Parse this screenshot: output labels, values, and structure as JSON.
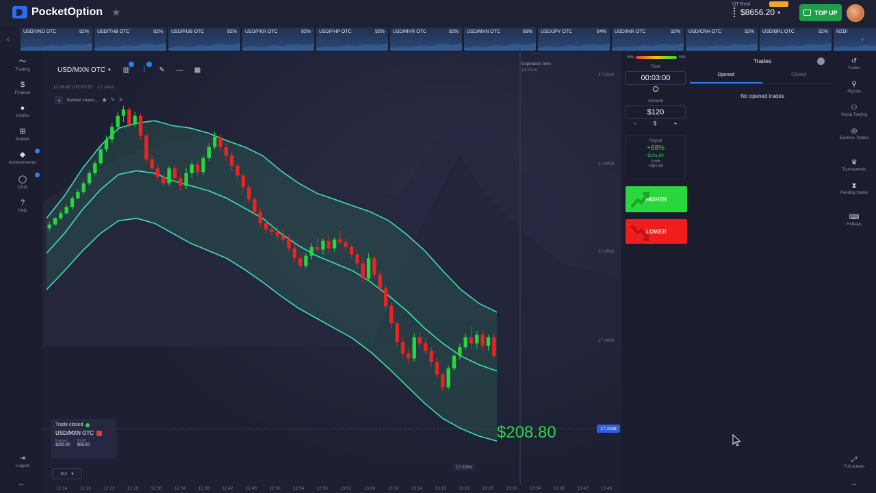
{
  "brand": {
    "name": "PocketOption"
  },
  "header": {
    "account_mode": "QT Real",
    "balance": "$8656.20",
    "topup_label": "TOP UP"
  },
  "asset_strip": [
    {
      "name": "USD/VND OTC",
      "payout": "92%"
    },
    {
      "name": "USD/THB OTC",
      "payout": "92%"
    },
    {
      "name": "USD/RUB OTC",
      "payout": "92%"
    },
    {
      "name": "USD/PKR OTC",
      "payout": "92%"
    },
    {
      "name": "USD/PHP OTC",
      "payout": "92%"
    },
    {
      "name": "USD/MYR OTC",
      "payout": "92%"
    },
    {
      "name": "USD/MXN OTC",
      "payout": "68%"
    },
    {
      "name": "USD/JPY OTC",
      "payout": "64%"
    },
    {
      "name": "USD/INR OTC",
      "payout": "92%"
    },
    {
      "name": "USD/CNH OTC",
      "payout": "92%"
    },
    {
      "name": "USD/BRL OTC",
      "payout": "92%"
    },
    {
      "name": "NZD/",
      "payout": ""
    }
  ],
  "left_nav": [
    {
      "label": "Trading",
      "icon": "chart-line-icon"
    },
    {
      "label": "Finance",
      "icon": "dollar-icon"
    },
    {
      "label": "Profile",
      "icon": "user-icon"
    },
    {
      "label": "Market",
      "icon": "cart-icon"
    },
    {
      "label": "Achievements",
      "icon": "diamond-icon"
    },
    {
      "label": "Chat",
      "icon": "chat-icon"
    },
    {
      "label": "Help",
      "icon": "help-icon"
    }
  ],
  "logout_label": "Logout",
  "chart": {
    "pair": "USD/MXN OTC",
    "server_time": "13:26:45 UTC+3:30",
    "header_price": "17.3418",
    "indicator": "Keltner chann...",
    "expiration_label": "Expiration time",
    "expiration_value": "13:28:40",
    "profit_overlay": "$208.80",
    "current_price": "17.3388",
    "low_price": "17.3364",
    "timeframe": "M2",
    "price_ticks": [
      "17.5000",
      "17.5000",
      "17.4500",
      "17.4000"
    ],
    "time_ticks": [
      "12:14",
      "12:18",
      "12:22",
      "12:26",
      "12:30",
      "12:34",
      "12:38",
      "12:42",
      "12:46",
      "12:50",
      "12:54",
      "12:58",
      "13:02",
      "13:06",
      "13:10",
      "13:14",
      "13:18",
      "13:22",
      "13:26",
      "13:30",
      "13:34",
      "13:38",
      "13:42",
      "13:46"
    ]
  },
  "trade_closed": {
    "title": "Trade closed",
    "pair": "USD/MXN OTC",
    "payout_label": "Payout",
    "payout_value": "$208.80",
    "profit_label": "Profit",
    "profit_value": "$88.80"
  },
  "trade_panel": {
    "sentiment_left": "50%",
    "sentiment_right": "50%",
    "time_label": "Time",
    "time_value": "00:03:00",
    "amount_label": "Amount",
    "amount_value": "$120",
    "amount_minus": "-",
    "amount_currency": "$",
    "amount_plus": "+",
    "payout_label": "Payout",
    "payout_pct": "+68%",
    "payout_amount": "$201.60",
    "profit_label": "Profit",
    "profit_value": "+$81.60",
    "higher_label": "HIGHER",
    "lower_label": "LOWER"
  },
  "trades_panel": {
    "title": "Trades",
    "tab_opened": "Opened",
    "tab_closed": "Closed",
    "empty_message": "No opened trades"
  },
  "right_nav": [
    {
      "label": "Trades",
      "icon": "history-icon"
    },
    {
      "label": "Signals",
      "icon": "signal-icon"
    },
    {
      "label": "Social Trading",
      "icon": "people-icon"
    },
    {
      "label": "Express Trades",
      "icon": "express-icon"
    },
    {
      "label": "Tournaments",
      "icon": "trophy-icon"
    },
    {
      "label": "Pending trades",
      "icon": "hourglass-icon"
    },
    {
      "label": "Hotkeys",
      "icon": "keyboard-icon"
    }
  ],
  "fullscreen_label": "Full screen",
  "colors": {
    "bull": "#27d83a",
    "bear": "#ee2222",
    "keltner": "#3fe3b0",
    "accent": "#2e7cf6"
  },
  "chart_data": {
    "type": "candlestick",
    "candles": [
      [
        17.432,
        17.437,
        17.43,
        17.435
      ],
      [
        17.435,
        17.441,
        17.434,
        17.44
      ],
      [
        17.44,
        17.446,
        17.439,
        17.444
      ],
      [
        17.444,
        17.451,
        17.443,
        17.449
      ],
      [
        17.449,
        17.458,
        17.447,
        17.456
      ],
      [
        17.456,
        17.463,
        17.455,
        17.461
      ],
      [
        17.461,
        17.47,
        17.459,
        17.468
      ],
      [
        17.468,
        17.478,
        17.466,
        17.476
      ],
      [
        17.476,
        17.486,
        17.474,
        17.484
      ],
      [
        17.484,
        17.497,
        17.482,
        17.495
      ],
      [
        17.495,
        17.506,
        17.493,
        17.503
      ],
      [
        17.503,
        17.516,
        17.5,
        17.513
      ],
      [
        17.513,
        17.525,
        17.51,
        17.522
      ],
      [
        17.522,
        17.53,
        17.517,
        17.527
      ],
      [
        17.527,
        17.529,
        17.512,
        17.515
      ],
      [
        17.515,
        17.525,
        17.513,
        17.522
      ],
      [
        17.522,
        17.524,
        17.503,
        17.506
      ],
      [
        17.506,
        17.508,
        17.484,
        17.487
      ],
      [
        17.487,
        17.49,
        17.478,
        17.48
      ],
      [
        17.48,
        17.483,
        17.47,
        17.473
      ],
      [
        17.473,
        17.476,
        17.465,
        17.468
      ],
      [
        17.468,
        17.482,
        17.466,
        17.48
      ],
      [
        17.48,
        17.483,
        17.469,
        17.472
      ],
      [
        17.472,
        17.475,
        17.462,
        17.466
      ],
      [
        17.466,
        17.48,
        17.463,
        17.476
      ],
      [
        17.476,
        17.486,
        17.472,
        17.483
      ],
      [
        17.483,
        17.486,
        17.474,
        17.477
      ],
      [
        17.477,
        17.49,
        17.475,
        17.488
      ],
      [
        17.488,
        17.5,
        17.486,
        17.497
      ],
      [
        17.497,
        17.509,
        17.495,
        17.505
      ],
      [
        17.505,
        17.507,
        17.494,
        17.497
      ],
      [
        17.497,
        17.5,
        17.486,
        17.49
      ],
      [
        17.49,
        17.493,
        17.478,
        17.482
      ],
      [
        17.482,
        17.484,
        17.47,
        17.474
      ],
      [
        17.474,
        17.476,
        17.462,
        17.465
      ],
      [
        17.465,
        17.467,
        17.452,
        17.455
      ],
      [
        17.455,
        17.457,
        17.442,
        17.445
      ],
      [
        17.445,
        17.448,
        17.433,
        17.436
      ],
      [
        17.436,
        17.44,
        17.428,
        17.431
      ],
      [
        17.431,
        17.436,
        17.426,
        17.429
      ],
      [
        17.429,
        17.434,
        17.423,
        17.426
      ],
      [
        17.426,
        17.431,
        17.42,
        17.423
      ],
      [
        17.423,
        17.427,
        17.413,
        17.416
      ],
      [
        17.416,
        17.42,
        17.405,
        17.408
      ],
      [
        17.408,
        17.411,
        17.399,
        17.402
      ],
      [
        17.402,
        17.412,
        17.4,
        17.41
      ],
      [
        17.41,
        17.42,
        17.407,
        17.417
      ],
      [
        17.417,
        17.424,
        17.412,
        17.415
      ],
      [
        17.415,
        17.424,
        17.411,
        17.422
      ],
      [
        17.422,
        17.426,
        17.413,
        17.416
      ],
      [
        17.416,
        17.425,
        17.413,
        17.423
      ],
      [
        17.423,
        17.43,
        17.419,
        17.421
      ],
      [
        17.421,
        17.424,
        17.414,
        17.417
      ],
      [
        17.417,
        17.419,
        17.408,
        17.411
      ],
      [
        17.411,
        17.414,
        17.4,
        17.404
      ],
      [
        17.404,
        17.409,
        17.388,
        17.392
      ],
      [
        17.392,
        17.412,
        17.39,
        17.408
      ],
      [
        17.408,
        17.41,
        17.392,
        17.395
      ],
      [
        17.395,
        17.398,
        17.38,
        17.384
      ],
      [
        17.384,
        17.386,
        17.366,
        17.37
      ],
      [
        17.37,
        17.372,
        17.352,
        17.356
      ],
      [
        17.356,
        17.358,
        17.337,
        17.341
      ],
      [
        17.341,
        17.345,
        17.328,
        17.332
      ],
      [
        17.332,
        17.336,
        17.324,
        17.328
      ],
      [
        17.328,
        17.348,
        17.325,
        17.345
      ],
      [
        17.345,
        17.35,
        17.337,
        17.34
      ],
      [
        17.34,
        17.344,
        17.331,
        17.334
      ],
      [
        17.334,
        17.337,
        17.322,
        17.325
      ],
      [
        17.325,
        17.328,
        17.312,
        17.315
      ],
      [
        17.315,
        17.317,
        17.302,
        17.305
      ],
      [
        17.305,
        17.322,
        17.303,
        17.32
      ],
      [
        17.32,
        17.332,
        17.318,
        17.33
      ],
      [
        17.33,
        17.34,
        17.327,
        17.337
      ],
      [
        17.337,
        17.348,
        17.335,
        17.345
      ],
      [
        17.345,
        17.353,
        17.336,
        17.34
      ],
      [
        17.34,
        17.35,
        17.336,
        17.347
      ],
      [
        17.347,
        17.351,
        17.334,
        17.338
      ],
      [
        17.338,
        17.347,
        17.334,
        17.345
      ],
      [
        17.345,
        17.348,
        17.328,
        17.33
      ]
    ],
    "keltner": {
      "upper": [
        17.44,
        17.458,
        17.48,
        17.498,
        17.512,
        17.516,
        17.518,
        17.514,
        17.512,
        17.508,
        17.502,
        17.497,
        17.49,
        17.478,
        17.468,
        17.46,
        17.455,
        17.45,
        17.445,
        17.438,
        17.427,
        17.414,
        17.398,
        17.383,
        17.372,
        17.365
      ],
      "middle": [
        17.412,
        17.428,
        17.447,
        17.463,
        17.475,
        17.478,
        17.476,
        17.47,
        17.466,
        17.462,
        17.456,
        17.448,
        17.44,
        17.428,
        17.418,
        17.41,
        17.404,
        17.398,
        17.389,
        17.378,
        17.366,
        17.352,
        17.34,
        17.33,
        17.323,
        17.318
      ],
      "lower": [
        17.383,
        17.398,
        17.414,
        17.428,
        17.438,
        17.44,
        17.436,
        17.428,
        17.42,
        17.414,
        17.408,
        17.399,
        17.389,
        17.378,
        17.368,
        17.36,
        17.352,
        17.344,
        17.333,
        17.32,
        17.306,
        17.292,
        17.28,
        17.272,
        17.266,
        17.262
      ]
    },
    "ylim": [
      17.25,
      17.54
    ]
  }
}
